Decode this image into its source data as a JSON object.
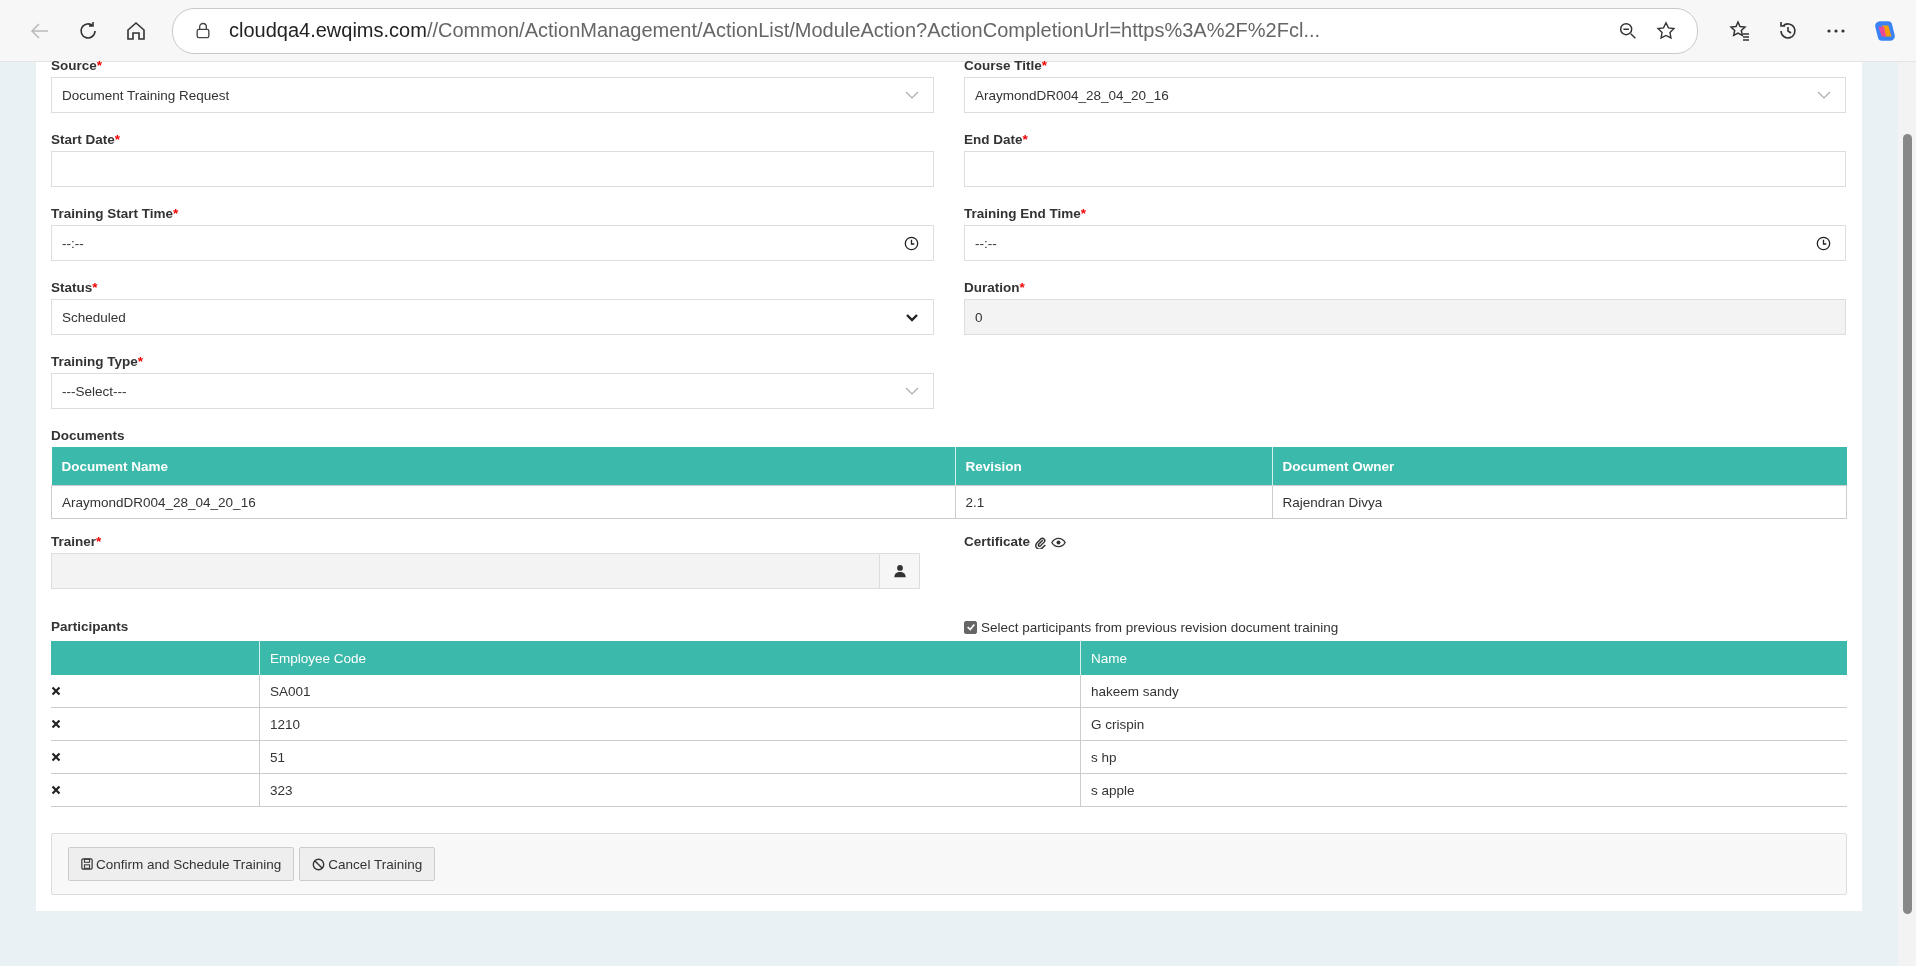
{
  "browser": {
    "url_host": "cloudqa4.ewqims.com",
    "url_path": "//Common/ActionManagement/ActionList/ModuleAction?ActionCompletionUrl=https%3A%2F%2Fcl...",
    "back_disabled": true
  },
  "fields": [
    {
      "label": "Source",
      "required_mark": "*",
      "kind": "select",
      "value": "Document Training Request"
    },
    {
      "label": "Course Title",
      "required_mark": "*",
      "kind": "select",
      "value": "AraymondDR004_28_04_20_16"
    },
    {
      "label": "Start Date",
      "required_mark": "*",
      "kind": "text"
    },
    {
      "label": "End Date",
      "required_mark": "*",
      "kind": "text"
    },
    {
      "label": "Training Start Time",
      "required_mark": "*",
      "kind": "time",
      "value": "--:--"
    },
    {
      "label": "Training End Time",
      "required_mark": "*",
      "kind": "time",
      "value": "--:--"
    },
    {
      "label": "Status",
      "required_mark": "*",
      "kind": "dropdown",
      "value": "Scheduled"
    },
    {
      "label": "Duration",
      "required_mark": "*",
      "kind": "readonly",
      "value": "0"
    },
    {
      "label": "Training Type",
      "required_mark": "*",
      "kind": "select",
      "value": "---Select---"
    }
  ],
  "documents": {
    "title": "Documents",
    "columns": [
      "Document Name",
      "Revision",
      "Document Owner"
    ],
    "rows": [
      [
        "AraymondDR004_28_04_20_16",
        "2.1",
        "Rajendran Divya"
      ]
    ]
  },
  "trainer": {
    "label": "Trainer",
    "required_mark": "*"
  },
  "certificate": {
    "label": "Certificate"
  },
  "participants": {
    "title": "Participants",
    "checkbox_label": "Select participants from previous revision document training",
    "checked": true,
    "columns": [
      "Employee Code",
      "Name"
    ],
    "rows": [
      [
        "SA001",
        "hakeem sandy"
      ],
      [
        "1210",
        "G crispin"
      ],
      [
        "51",
        "s hp"
      ],
      [
        "323",
        "s apple"
      ]
    ]
  },
  "buttons": [
    {
      "label": "Confirm and Schedule Training",
      "kind": "save"
    },
    {
      "label": "Cancel Training",
      "kind": "cancel"
    }
  ]
}
